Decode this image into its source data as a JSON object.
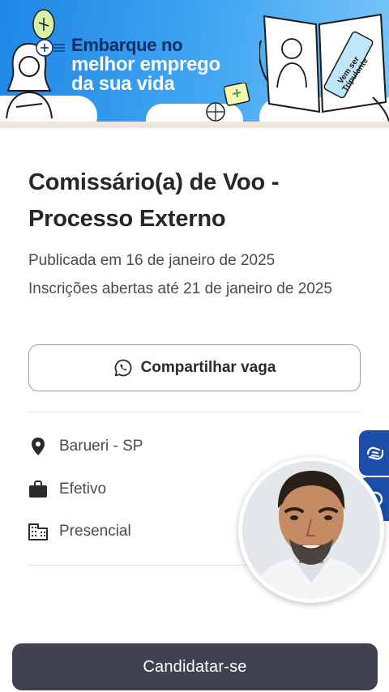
{
  "banner": {
    "line1": "Embarque no",
    "line2": "melhor emprego",
    "line3": "da sua vida",
    "passport_text": "Vem ser Tripulante"
  },
  "job": {
    "title": "Comissário(a) de Voo - Processo Externo",
    "published": "Publicada em 16 de janeiro de 2025",
    "deadline": "Inscrições abertas até 21 de janeiro de 2025"
  },
  "share": {
    "label": "Compartilhar vaga",
    "icon": "whatsapp-icon"
  },
  "details": [
    {
      "icon": "location-pin-icon",
      "label": "Barueri - SP"
    },
    {
      "icon": "briefcase-icon",
      "label": "Efetivo"
    },
    {
      "icon": "building-icon",
      "label": "Presencial"
    }
  ],
  "accessibility": {
    "sign_language_icon": "sign-language-icon",
    "extra_icon": "accessibility-icon"
  },
  "apply": {
    "label": "Candidatar-se"
  },
  "colors": {
    "banner_blue": "#1e86e6",
    "title_navy": "#0d2d6b",
    "apply_button": "#3f4350",
    "a11y_tab": "#1d4ea8"
  }
}
